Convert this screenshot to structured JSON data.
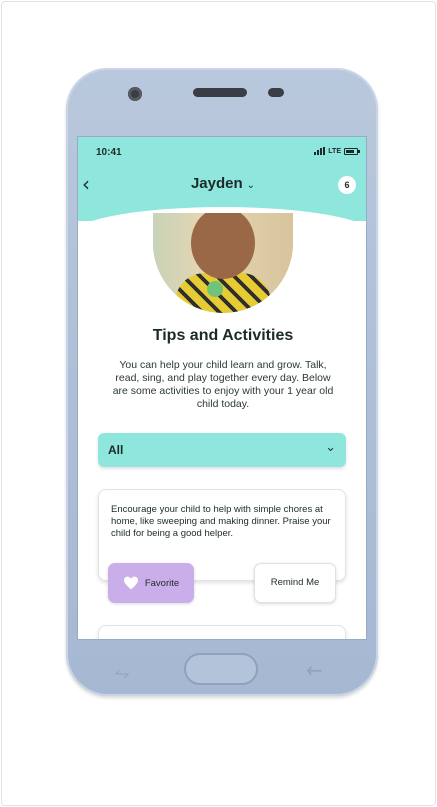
{
  "status_bar": {
    "time": "10:41",
    "network": "LTE"
  },
  "header": {
    "child_name": "Jayden",
    "chevron": "⌄",
    "notification_count": "6",
    "back_icon": "chevron-left-icon"
  },
  "main": {
    "title": "Tips and Activities",
    "intro": "You can help your child learn and grow. Talk, read, sing, and play together every day. Below are some activities to enjoy with your 1 year old child today."
  },
  "filter": {
    "selected": "All"
  },
  "activity_card": {
    "text": "Encourage your child to help with simple chores at home, like sweeping and making dinner. Praise your child for being a good helper.",
    "favorite_label": "Favorite",
    "remind_label": "Remind Me"
  },
  "colors": {
    "accent": "#8fe6dc",
    "favorite": "#c9aeea",
    "phone": "#aebfd7"
  }
}
